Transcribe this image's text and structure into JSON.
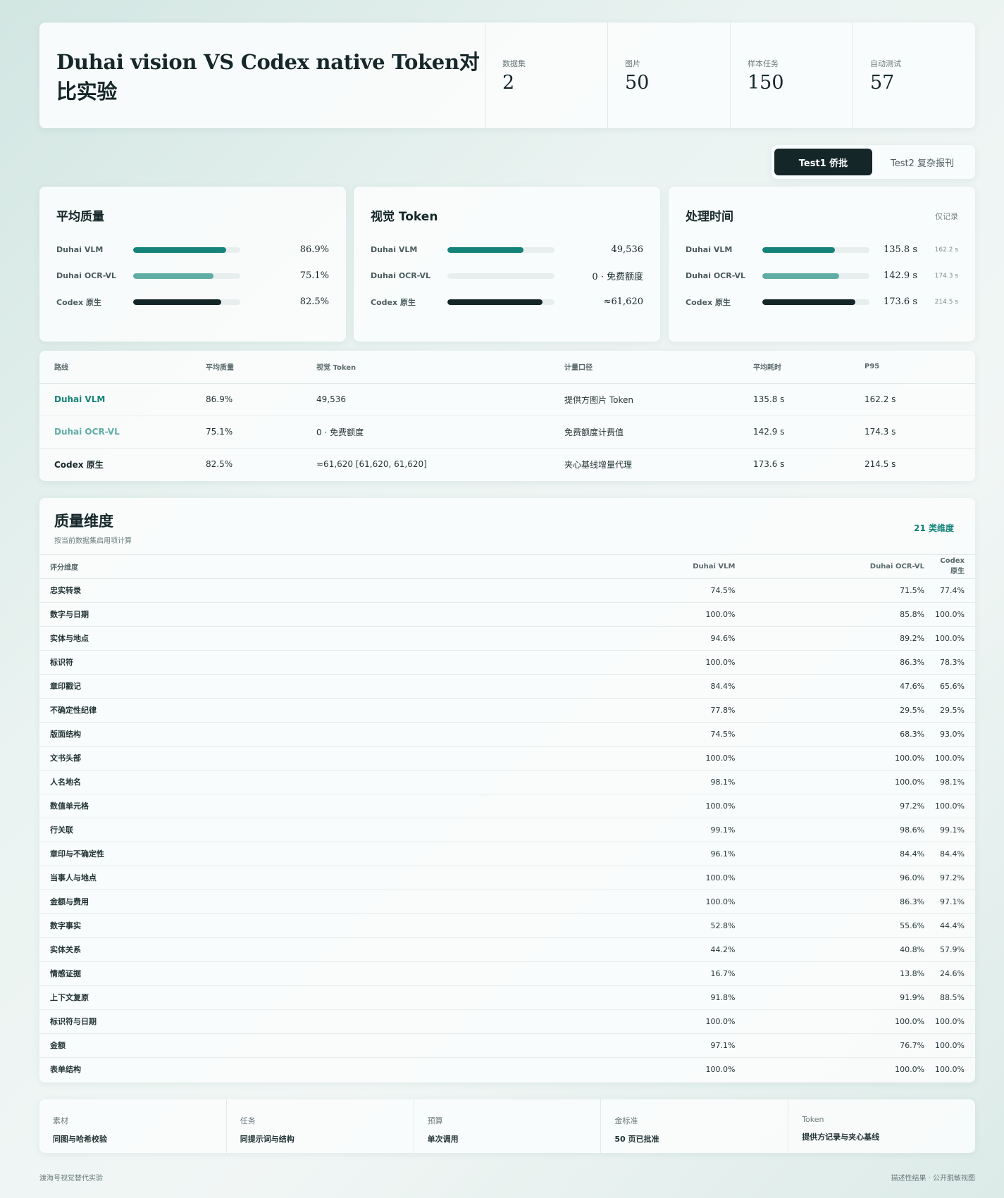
{
  "header": {
    "title": "Duhai vision VS Codex native Token对比实验",
    "stats": [
      {
        "label": "数据集",
        "value": "2"
      },
      {
        "label": "图片",
        "value": "50"
      },
      {
        "label": "样本任务",
        "value": "150"
      },
      {
        "label": "自动测试",
        "value": "57"
      }
    ]
  },
  "tabs": [
    {
      "label": "Test1 侨批",
      "active": true
    },
    {
      "label": "Test2 复杂报刊",
      "active": false
    }
  ],
  "colors": {
    "vlm": "#158379",
    "ocr": "#5fada5",
    "codex": "#152628"
  },
  "metrics": {
    "quality": {
      "title": "平均质量",
      "rows": [
        {
          "label": "Duhai VLM",
          "value": "86.9%",
          "fraction": 0.869
        },
        {
          "label": "Duhai OCR-VL",
          "value": "75.1%",
          "fraction": 0.751
        },
        {
          "label": "Codex 原生",
          "value": "82.5%",
          "fraction": 0.825
        }
      ]
    },
    "token": {
      "title": "视觉 Token",
      "rows": [
        {
          "label": "Duhai VLM",
          "value": "49,536",
          "fraction": 0.71
        },
        {
          "label": "Duhai OCR-VL",
          "value": "0 · 免费额度",
          "fraction": 0
        },
        {
          "label": "Codex 原生",
          "value": "≈61,620",
          "fraction": 0.885
        }
      ]
    },
    "time": {
      "title": "处理时间",
      "note": "仅记录",
      "rows": [
        {
          "label": "Duhai VLM",
          "value": "135.8 s",
          "p95": "162.2 s",
          "fraction": 0.68
        },
        {
          "label": "Duhai OCR-VL",
          "value": "142.9 s",
          "p95": "174.3 s",
          "fraction": 0.715
        },
        {
          "label": "Codex 原生",
          "value": "173.6 s",
          "p95": "214.5 s",
          "fraction": 0.87
        }
      ]
    }
  },
  "summary": {
    "headers": [
      "路线",
      "平均质量",
      "视觉 Token",
      "计量口径",
      "平均耗时",
      "P95"
    ],
    "rows": [
      {
        "route": "Duhai VLM",
        "quality": "86.9%",
        "token": "49,536",
        "basis": "提供方图片 Token",
        "avg": "135.8 s",
        "p95": "162.2 s"
      },
      {
        "route": "Duhai OCR-VL",
        "quality": "75.1%",
        "token": "0 · 免费额度",
        "basis": "免费额度计费值",
        "avg": "142.9 s",
        "p95": "174.3 s"
      },
      {
        "route": "Codex 原生",
        "quality": "82.5%",
        "token": "≈61,620 [61,620, 61,620]",
        "basis": "夹心基线增量代理",
        "avg": "173.6 s",
        "p95": "214.5 s"
      }
    ]
  },
  "quality_dims": {
    "title": "质量维度",
    "subtitle": "按当前数据集启用项计算",
    "count": "21 类维度",
    "headers": [
      "评分维度",
      "Duhai VLM",
      "Duhai OCR-VL",
      "Codex 原生"
    ],
    "rows": [
      [
        "忠实转录",
        "74.5%",
        "71.5%",
        "77.4%"
      ],
      [
        "数字与日期",
        "100.0%",
        "85.8%",
        "100.0%"
      ],
      [
        "实体与地点",
        "94.6%",
        "89.2%",
        "100.0%"
      ],
      [
        "标识符",
        "100.0%",
        "86.3%",
        "78.3%"
      ],
      [
        "章印戳记",
        "84.4%",
        "47.6%",
        "65.6%"
      ],
      [
        "不确定性纪律",
        "77.8%",
        "29.5%",
        "29.5%"
      ],
      [
        "版面结构",
        "74.5%",
        "68.3%",
        "93.0%"
      ],
      [
        "文书头部",
        "100.0%",
        "100.0%",
        "100.0%"
      ],
      [
        "人名地名",
        "98.1%",
        "100.0%",
        "98.1%"
      ],
      [
        "数值单元格",
        "100.0%",
        "97.2%",
        "100.0%"
      ],
      [
        "行关联",
        "99.1%",
        "98.6%",
        "99.1%"
      ],
      [
        "章印与不确定性",
        "96.1%",
        "84.4%",
        "84.4%"
      ],
      [
        "当事人与地点",
        "100.0%",
        "96.0%",
        "97.2%"
      ],
      [
        "金额与费用",
        "100.0%",
        "86.3%",
        "97.1%"
      ],
      [
        "数字事实",
        "52.8%",
        "55.6%",
        "44.4%"
      ],
      [
        "实体关系",
        "44.2%",
        "40.8%",
        "57.9%"
      ],
      [
        "情感证据",
        "16.7%",
        "13.8%",
        "24.6%"
      ],
      [
        "上下文复原",
        "91.8%",
        "91.9%",
        "88.5%"
      ],
      [
        "标识符与日期",
        "100.0%",
        "100.0%",
        "100.0%"
      ],
      [
        "金额",
        "97.1%",
        "76.7%",
        "100.0%"
      ],
      [
        "表单结构",
        "100.0%",
        "100.0%",
        "100.0%"
      ]
    ]
  },
  "footer_cards": [
    {
      "label": "素材",
      "value": "同图与哈希校验"
    },
    {
      "label": "任务",
      "value": "同提示词与结构"
    },
    {
      "label": "预算",
      "value": "单次调用"
    },
    {
      "label": "金标准",
      "value": "50 页已批准"
    },
    {
      "label": "Token",
      "value": "提供方记录与夹心基线"
    }
  ],
  "footer": {
    "left": "渡海号视觉替代实验",
    "right": "描述性结果 · 公开脱敏视图"
  }
}
